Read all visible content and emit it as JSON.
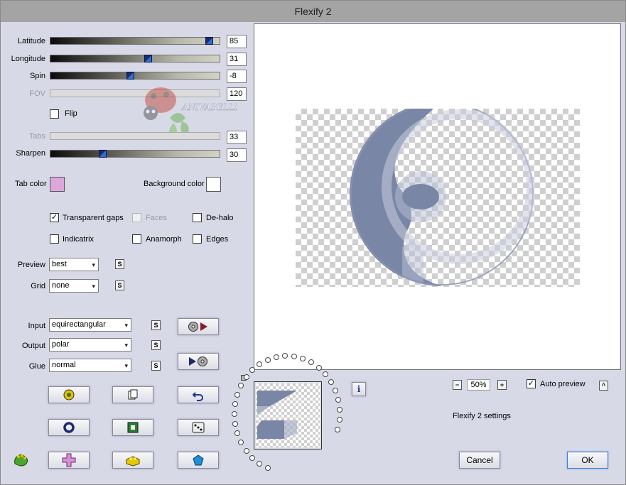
{
  "window": {
    "title": "Flexify 2"
  },
  "colors": {
    "tab_color": "#dca8dc",
    "background_color": "#ffffff",
    "shape": "#7a86a6"
  },
  "sliders": {
    "latitude": {
      "label": "Latitude",
      "value": "85",
      "fraction": 0.96
    },
    "longitude": {
      "label": "Longitude",
      "value": "31",
      "fraction": 0.58
    },
    "spin": {
      "label": "Spin",
      "value": "-8",
      "fraction": 0.47
    },
    "fov": {
      "label": "FOV",
      "value": "120"
    },
    "tabs": {
      "label": "Tabs",
      "value": "33"
    },
    "sharpen": {
      "label": "Sharpen",
      "value": "30",
      "fraction": 0.3
    }
  },
  "flip": {
    "label": "Flip",
    "checked": ""
  },
  "watermark": "ANIVABELLE",
  "tab_color_label": "Tab color",
  "background_color_label": "Background color",
  "options": {
    "transparent_gaps": {
      "label": "Transparent gaps",
      "check": "✓"
    },
    "faces": {
      "label": "Faces"
    },
    "de_halo": {
      "label": "De-halo"
    },
    "indicatrix": {
      "label": "Indicatrix"
    },
    "anamorph": {
      "label": "Anamorph"
    },
    "edges": {
      "label": "Edges"
    }
  },
  "preview_select": {
    "label": "Preview",
    "value": "best"
  },
  "grid_select": {
    "label": "Grid",
    "value": "none"
  },
  "input_select": {
    "label": "Input",
    "value": "equirectangular"
  },
  "output_select": {
    "label": "Output",
    "value": "polar"
  },
  "glue_select": {
    "label": "Glue",
    "value": "normal"
  },
  "s_label": "S",
  "arrow_glyph": "▾",
  "zoom": {
    "minus": "−",
    "value": "50%",
    "plus": "+"
  },
  "auto_preview": {
    "label": "Auto preview",
    "check": "✓",
    "caret": "^"
  },
  "settings_name": "Flexify 2 settings",
  "info_glyph": "i",
  "buttons": {
    "cancel": "Cancel",
    "ok": "OK"
  }
}
